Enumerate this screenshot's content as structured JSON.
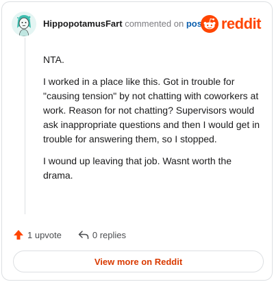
{
  "header": {
    "username": "HippopotamusFart",
    "verb": "commented on",
    "post_link": "post"
  },
  "logo": {
    "icon": "reddit-snoo-icon",
    "wordmark": "reddit",
    "color": "#ff4500"
  },
  "comment": {
    "paragraphs": [
      "NTA.",
      "I worked in a place like this. Got in trouble for \"causing tension\" by not chatting with coworkers at work. Reason for not chatting? Supervisors would ask inappropriate questions and then I would get in trouble for answering them, so I stopped.",
      "I wound up leaving that job. Wasnt worth the drama."
    ]
  },
  "actions": {
    "upvote_label": "1 upvote",
    "replies_label": "0 replies",
    "upvote_icon": "upvote-arrow-icon",
    "reply_icon": "reply-arrow-icon",
    "upvote_color": "#ff4500"
  },
  "footer": {
    "view_more_label": "View more on Reddit",
    "accent": "#d93a00"
  }
}
